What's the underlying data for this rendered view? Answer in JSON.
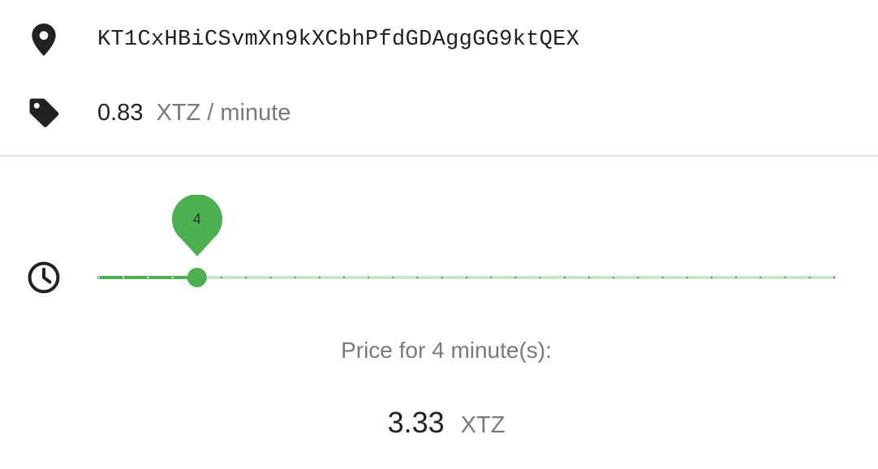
{
  "contract": {
    "address": "KT1CxHBiCSvmXn9kXCbhPfdGDAggGG9ktQEX",
    "icon": "location-pin-icon"
  },
  "rate": {
    "value": "0.83",
    "unit": "XTZ / minute",
    "icon": "price-tag-icon"
  },
  "duration_slider": {
    "icon": "clock-icon",
    "value": 4,
    "value_label": "4",
    "min": 0,
    "max": 30,
    "step": 1,
    "accent_color": "#4caf50",
    "track_inactive_color": "#c8e6c9"
  },
  "total": {
    "label": "Price for 4 minute(s):",
    "value": "3.33",
    "unit": "XTZ"
  }
}
